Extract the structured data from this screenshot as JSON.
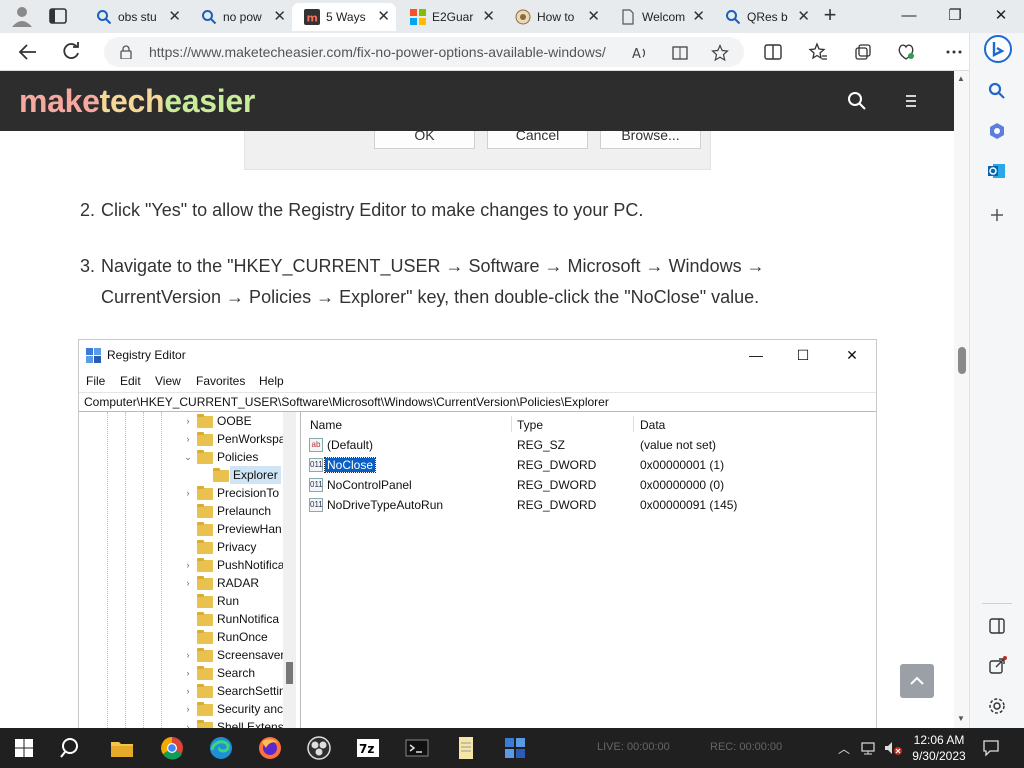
{
  "browser": {
    "tabs": [
      {
        "label": "obs stu",
        "icon": "search-icon",
        "active": false
      },
      {
        "label": "no pow",
        "icon": "search-icon",
        "active": false
      },
      {
        "label": "5 Ways",
        "icon": "mte-favicon",
        "active": true
      },
      {
        "label": "E2Guar",
        "icon": "windows-favicon",
        "active": false
      },
      {
        "label": "How to",
        "icon": "site-favicon",
        "active": false
      },
      {
        "label": "Welcom",
        "icon": "page-icon",
        "active": false
      },
      {
        "label": "QRes b",
        "icon": "search-icon",
        "active": false
      }
    ],
    "url": "https://www.maketecheasier.com/fix-no-power-options-available-windows/"
  },
  "site": {
    "logo": {
      "part1": "make",
      "part2": "tech",
      "part3": "easier"
    }
  },
  "dialog_buttons": {
    "ok": "OK",
    "cancel": "Cancel",
    "browse": "Browse..."
  },
  "article": {
    "steps": [
      {
        "num": "2.",
        "text": "Click \"Yes\" to allow the Registry Editor to make changes to your PC."
      },
      {
        "num": "3.",
        "line1": "Navigate to the \"HKEY_CURRENT_USER → Software → Microsoft → Windows →",
        "line2": "CurrentVersion → Policies → Explorer\" key, then double-click the \"NoClose\" value."
      }
    ]
  },
  "regedit": {
    "title": "Registry Editor",
    "menu": [
      "File",
      "Edit",
      "View",
      "Favorites",
      "Help"
    ],
    "address": "Computer\\HKEY_CURRENT_USER\\Software\\Microsoft\\Windows\\CurrentVersion\\Policies\\Explorer",
    "tree": [
      {
        "label": "OOBE",
        "chevron": "›"
      },
      {
        "label": "PenWorkspa",
        "chevron": "›"
      },
      {
        "label": "Policies",
        "chevron": "⌄"
      },
      {
        "label": "Explorer",
        "chevron": ""
      },
      {
        "label": "PrecisionTo",
        "chevron": "›"
      },
      {
        "label": "Prelaunch",
        "chevron": ""
      },
      {
        "label": "PreviewHan",
        "chevron": ""
      },
      {
        "label": "Privacy",
        "chevron": ""
      },
      {
        "label": "PushNotifica",
        "chevron": "›"
      },
      {
        "label": "RADAR",
        "chevron": "›"
      },
      {
        "label": "Run",
        "chevron": ""
      },
      {
        "label": "RunNotifica",
        "chevron": ""
      },
      {
        "label": "RunOnce",
        "chevron": ""
      },
      {
        "label": "Screensaver",
        "chevron": "›"
      },
      {
        "label": "Search",
        "chevron": "›"
      },
      {
        "label": "SearchSettin",
        "chevron": "›"
      },
      {
        "label": "Security anc",
        "chevron": "›"
      },
      {
        "label": "Shell Extens",
        "chevron": "›"
      }
    ],
    "columns": {
      "name": "Name",
      "type": "Type",
      "data": "Data"
    },
    "values": [
      {
        "name": "(Default)",
        "type": "REG_SZ",
        "data": "(value not set)",
        "kind": "ab"
      },
      {
        "name": "NoClose",
        "type": "REG_DWORD",
        "data": "0x00000001 (1)",
        "kind": "011"
      },
      {
        "name": "NoControlPanel",
        "type": "REG_DWORD",
        "data": "0x00000000 (0)",
        "kind": "011"
      },
      {
        "name": "NoDriveTypeAutoRun",
        "type": "REG_DWORD",
        "data": "0x00000091 (145)",
        "kind": "011"
      }
    ]
  },
  "taskbar": {
    "rec_live": "LIVE: 00:00:00",
    "rec_rec": "REC: 00:00:00",
    "time": "12:06 AM",
    "date": "9/30/2023"
  },
  "colors": {
    "tab_bar_bg": "#e8ebee",
    "site_header_bg": "#2d2d2d",
    "logo_make": "#f7a9a0",
    "logo_tech": "#f5d79a",
    "logo_easier": "#c8ec9a",
    "registry_selection": "#0a5fc4",
    "taskbar_bg": "#202020"
  }
}
